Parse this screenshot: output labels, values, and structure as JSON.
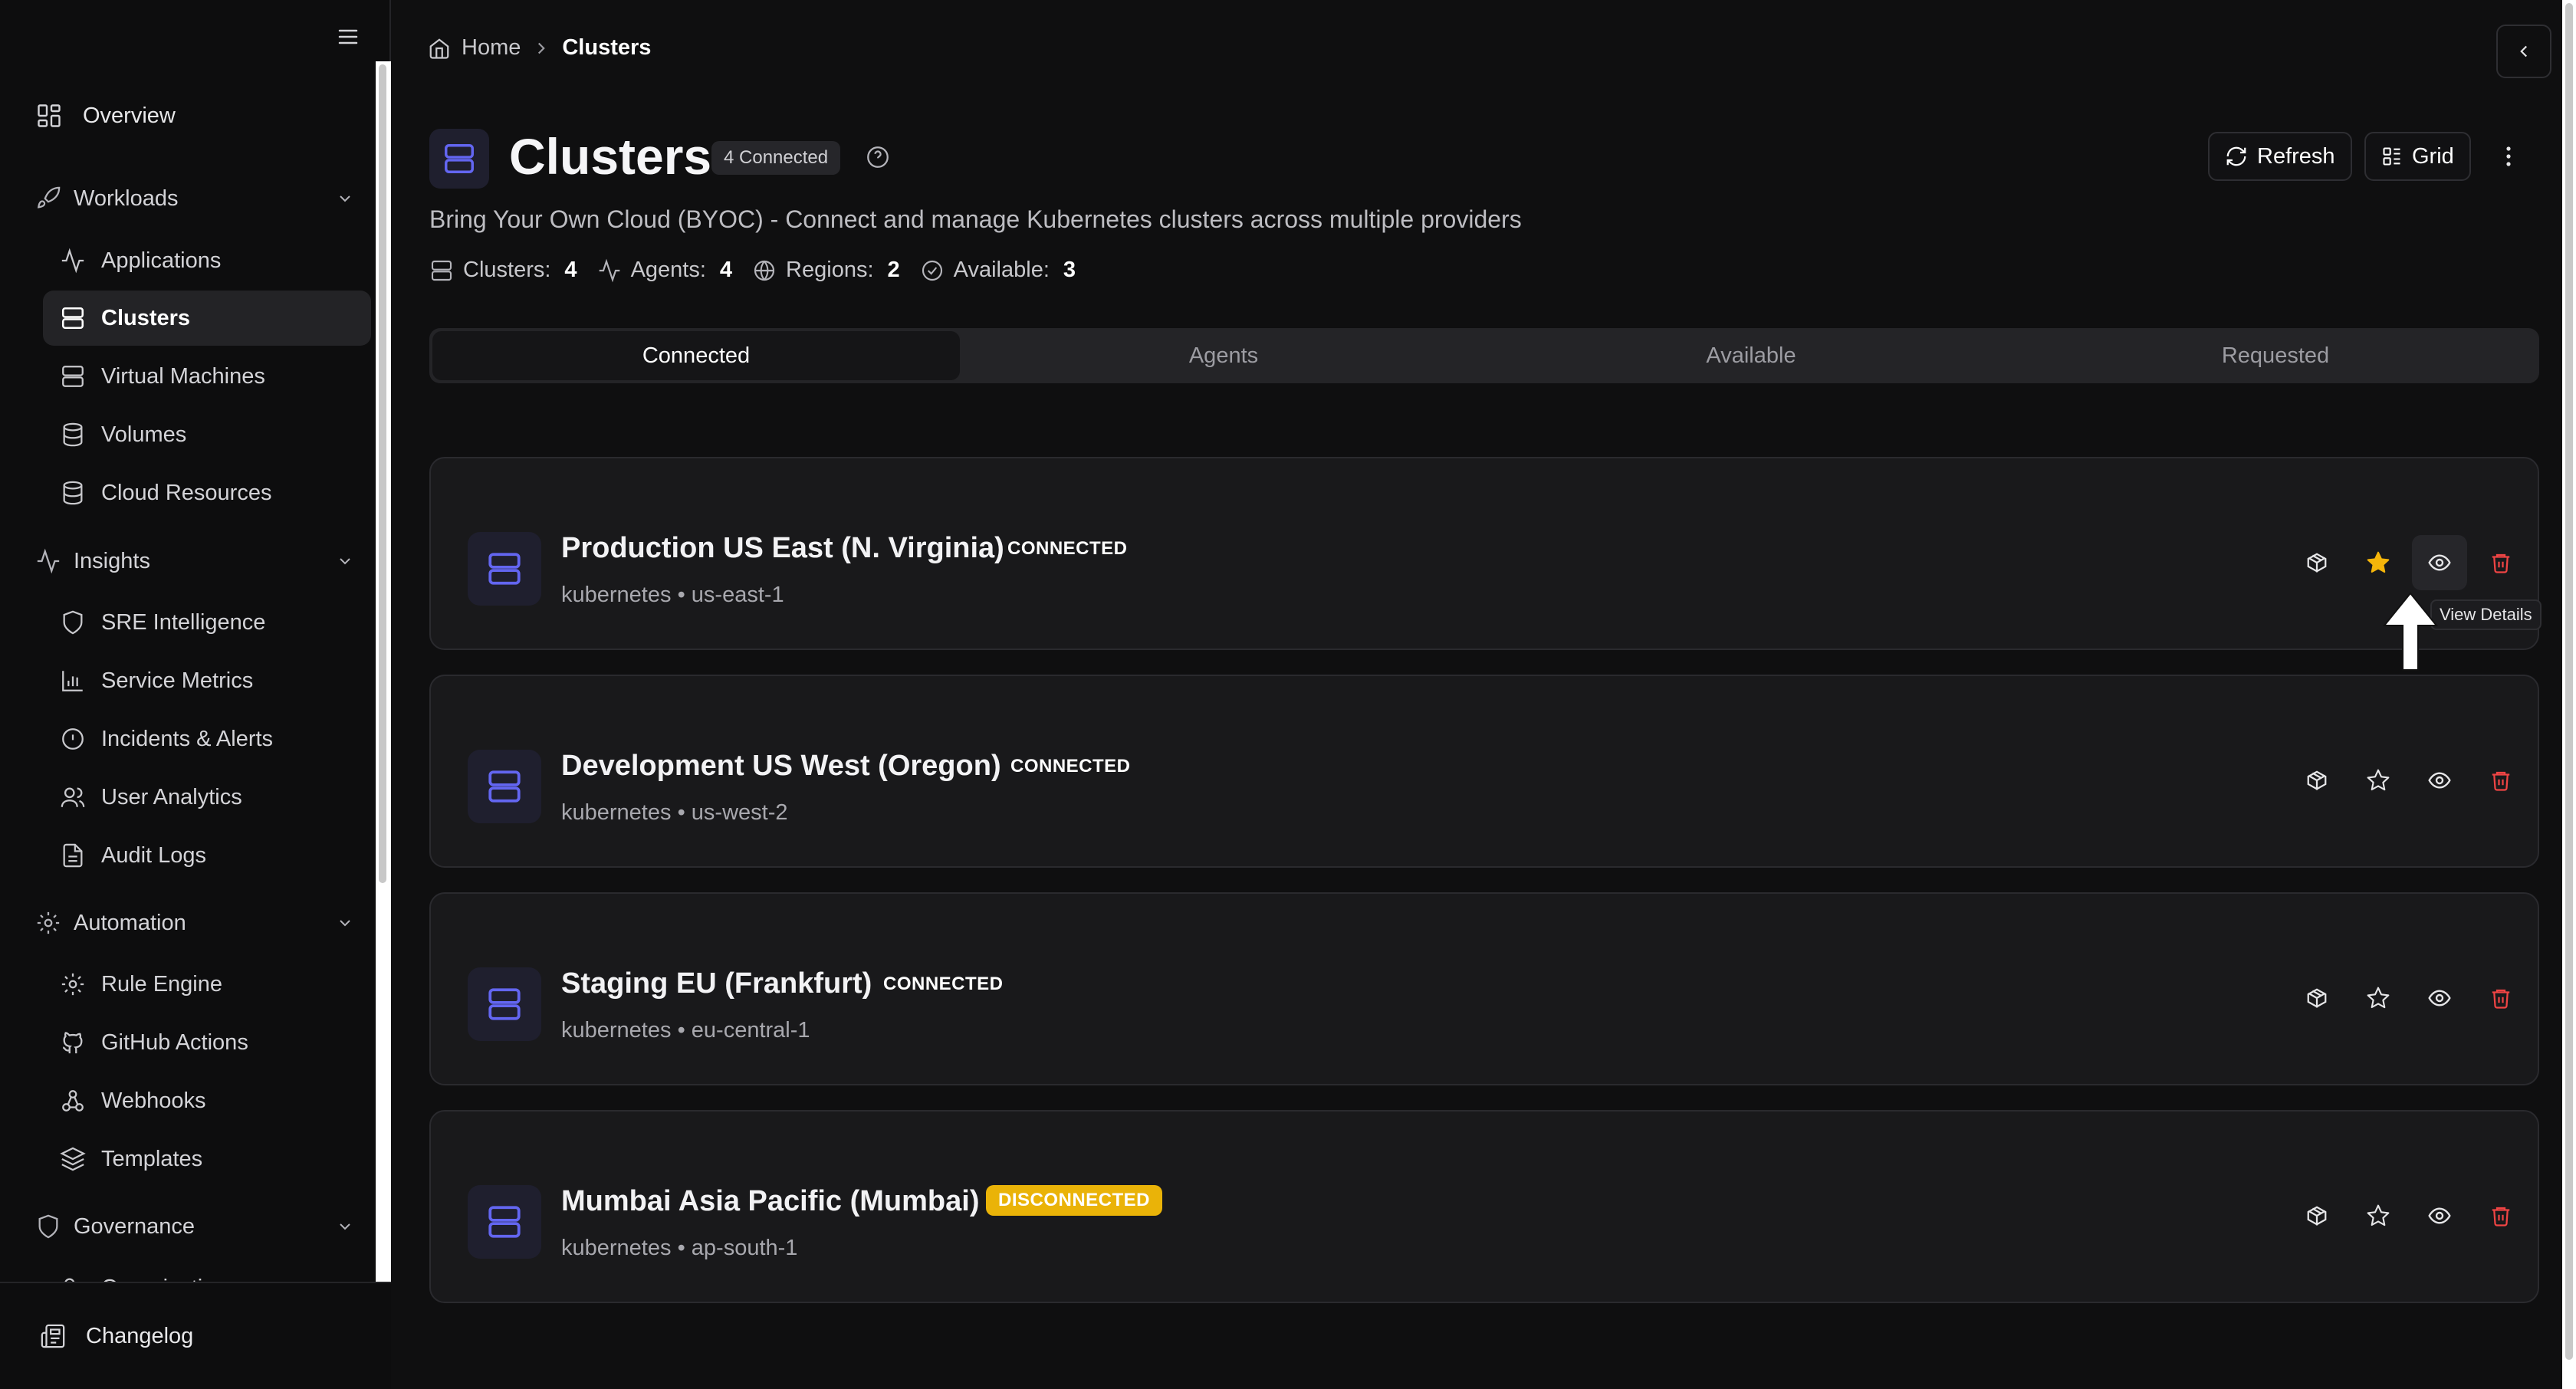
{
  "sidebar": {
    "top": {
      "label": "Overview",
      "icon": "grid-icon"
    },
    "groups": {
      "workloads": {
        "label": "Workloads",
        "items": [
          "Applications",
          "Clusters",
          "Virtual Machines",
          "Volumes",
          "Cloud Resources"
        ]
      },
      "insights": {
        "label": "Insights",
        "items": [
          "SRE Intelligence",
          "Service Metrics",
          "Incidents & Alerts",
          "User Analytics",
          "Audit Logs"
        ]
      },
      "automation": {
        "label": "Automation",
        "items": [
          "Rule Engine",
          "GitHub Actions",
          "Webhooks",
          "Templates"
        ]
      },
      "governance": {
        "label": "Governance",
        "items": [
          "Organization"
        ]
      }
    },
    "active_item": "Clusters",
    "bottom": {
      "label": "Changelog"
    }
  },
  "breadcrumb": {
    "home": "Home",
    "current": "Clusters"
  },
  "header": {
    "title": "Clusters",
    "badge": "4 Connected",
    "subtitle": "Bring Your Own Cloud (BYOC) - Connect and manage Kubernetes clusters across multiple providers",
    "stats": [
      {
        "label": "Clusters:",
        "value": "4"
      },
      {
        "label": "Agents:",
        "value": "4"
      },
      {
        "label": "Regions:",
        "value": "2"
      },
      {
        "label": "Available:",
        "value": "3"
      }
    ],
    "refresh_label": "Refresh",
    "grid_label": "Grid"
  },
  "tabs": [
    "Connected",
    "Agents",
    "Available",
    "Requested"
  ],
  "active_tab": "Connected",
  "clusters": [
    {
      "name": "Production US East (N. Virginia)",
      "status": "CONNECTED",
      "type": "kubernetes",
      "region": "us-east-1",
      "starred": true
    },
    {
      "name": "Development US West (Oregon)",
      "status": "CONNECTED",
      "type": "kubernetes",
      "region": "us-west-2",
      "starred": false
    },
    {
      "name": "Staging EU (Frankfurt)",
      "status": "CONNECTED",
      "type": "kubernetes",
      "region": "eu-central-1",
      "starred": false
    },
    {
      "name": "Mumbai Asia Pacific (Mumbai)",
      "status": "DISCONNECTED",
      "type": "kubernetes",
      "region": "ap-south-1",
      "starred": false
    }
  ],
  "separator": "•",
  "tooltip": "View Details",
  "colors": {
    "accent": "#6366f1",
    "star": "#f5b50a",
    "danger": "#ef4444",
    "warning": "#eab308"
  }
}
